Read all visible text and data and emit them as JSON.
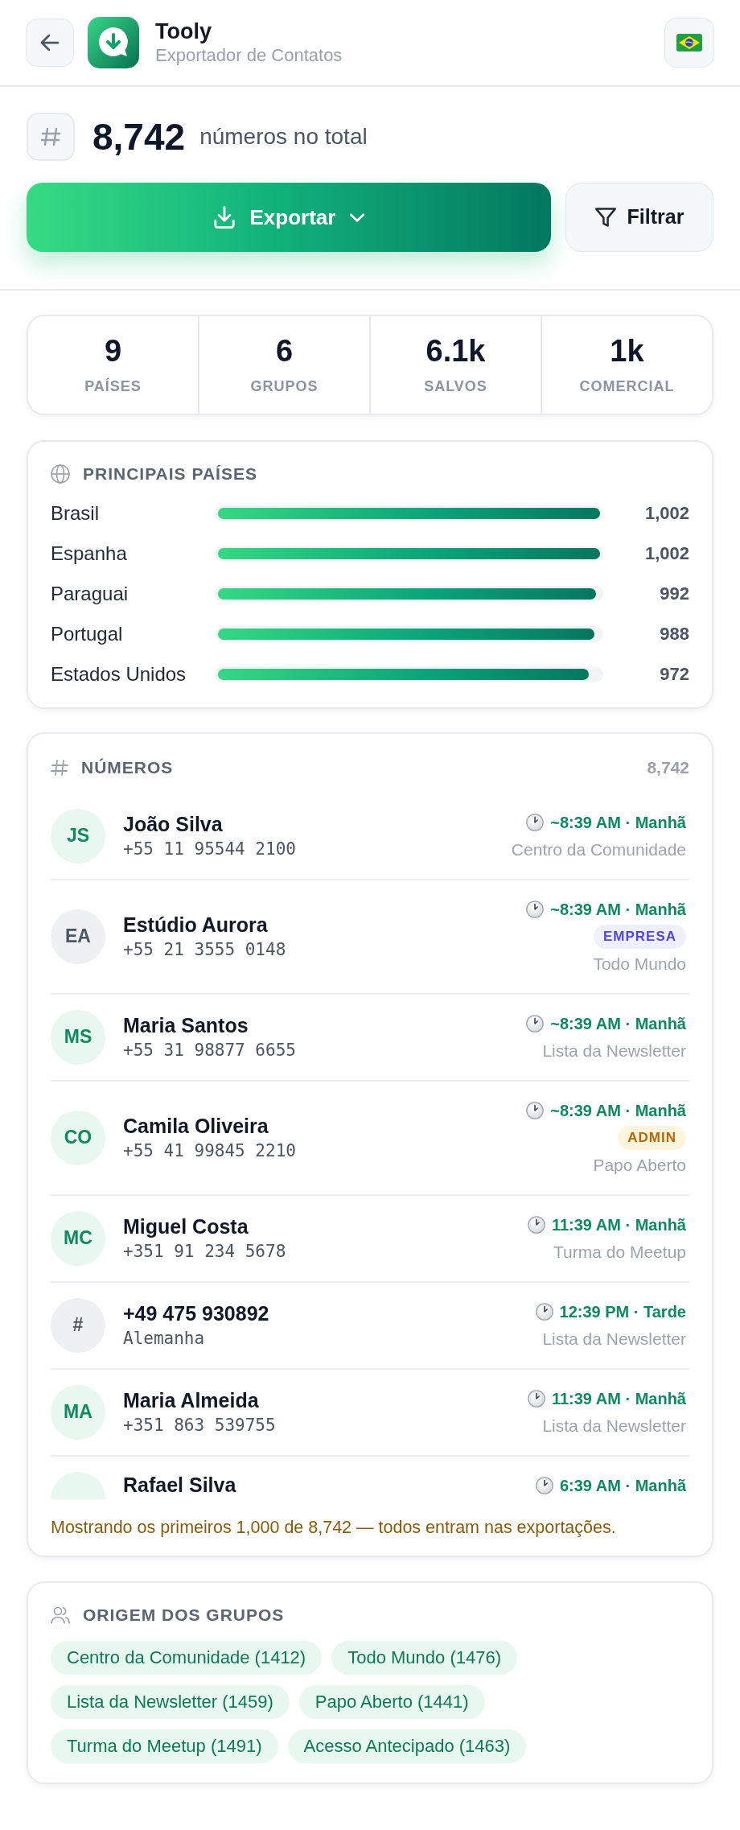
{
  "header": {
    "title": "Tooly",
    "subtitle": "Exportador de Contatos"
  },
  "total": {
    "value": "8,742",
    "label": "números no total"
  },
  "actions": {
    "export": "Exportar",
    "filter": "Filtrar"
  },
  "stats": [
    {
      "value": "9",
      "label": "PAÍSES"
    },
    {
      "value": "6",
      "label": "GRUPOS"
    },
    {
      "value": "6.1k",
      "label": "SALVOS"
    },
    {
      "value": "1k",
      "label": "COMERCIAL"
    }
  ],
  "countries": {
    "title": "PRINCIPAIS PAÍSES",
    "rows": [
      {
        "name": "Brasil",
        "level": 1.0,
        "count": "1,002"
      },
      {
        "name": "Espanha",
        "level": 1.0,
        "count": "1,002"
      },
      {
        "name": "Paraguai",
        "level": 0.99,
        "count": "992"
      },
      {
        "name": "Portugal",
        "level": 0.986,
        "count": "988"
      },
      {
        "name": "Estados Unidos",
        "level": 0.97,
        "count": "972"
      }
    ]
  },
  "numbers": {
    "title": "NÚMEROS",
    "count": "8,742",
    "rows": [
      {
        "kind": "contact",
        "initials": "JS",
        "title": "João Silva",
        "subtitle": "+55 11 95544 2100",
        "time": "~8:39 AM · Manhã",
        "group": "Centro da Comunidade"
      },
      {
        "kind": "business",
        "initials": "EA",
        "title": "Estúdio Aurora",
        "subtitle": "+55 21 3555 0148",
        "time": "~8:39 AM · Manhã",
        "badge": {
          "kind": "business",
          "text": "EMPRESA"
        },
        "group": "Todo Mundo"
      },
      {
        "kind": "contact",
        "initials": "MS",
        "title": "Maria Santos",
        "subtitle": "+55 31 98877 6655",
        "time": "~8:39 AM · Manhã",
        "group": "Lista da Newsletter"
      },
      {
        "kind": "contact",
        "initials": "CO",
        "title": "Camila Oliveira",
        "subtitle": "+55 41 99845 2210",
        "time": "~8:39 AM · Manhã",
        "badge": {
          "kind": "admin",
          "text": "ADMIN"
        },
        "group": "Papo Aberto"
      },
      {
        "kind": "contact",
        "initials": "MC",
        "title": "Miguel Costa",
        "subtitle": "+351 91 234 5678",
        "time": "11:39 AM · Manhã",
        "group": "Turma do Meetup"
      },
      {
        "kind": "unknown",
        "initials": "#",
        "title": "+49 475 930892",
        "subtitle": "Alemanha",
        "time": "12:39 PM · Tarde",
        "group": "Lista da Newsletter"
      },
      {
        "kind": "contact",
        "initials": "MA",
        "title": "Maria Almeida",
        "subtitle": "+351 863 539755",
        "time": "11:39 AM · Manhã",
        "group": "Lista da Newsletter"
      },
      {
        "kind": "contact",
        "title": "Rafael Silva",
        "time": "6:39 AM · Manhã"
      }
    ],
    "note": "Mostrando os primeiros 1,000 de 8,742 — todos entram nas exportações."
  },
  "groups": {
    "title": "ORIGEM DOS GRUPOS",
    "chips": [
      "Centro da Comunidade (1412)",
      "Todo Mundo (1476)",
      "Lista da Newsletter (1459)",
      "Papo Aberto (1441)",
      "Turma do Meetup (1491)",
      "Acesso Antecipado (1463)"
    ]
  }
}
